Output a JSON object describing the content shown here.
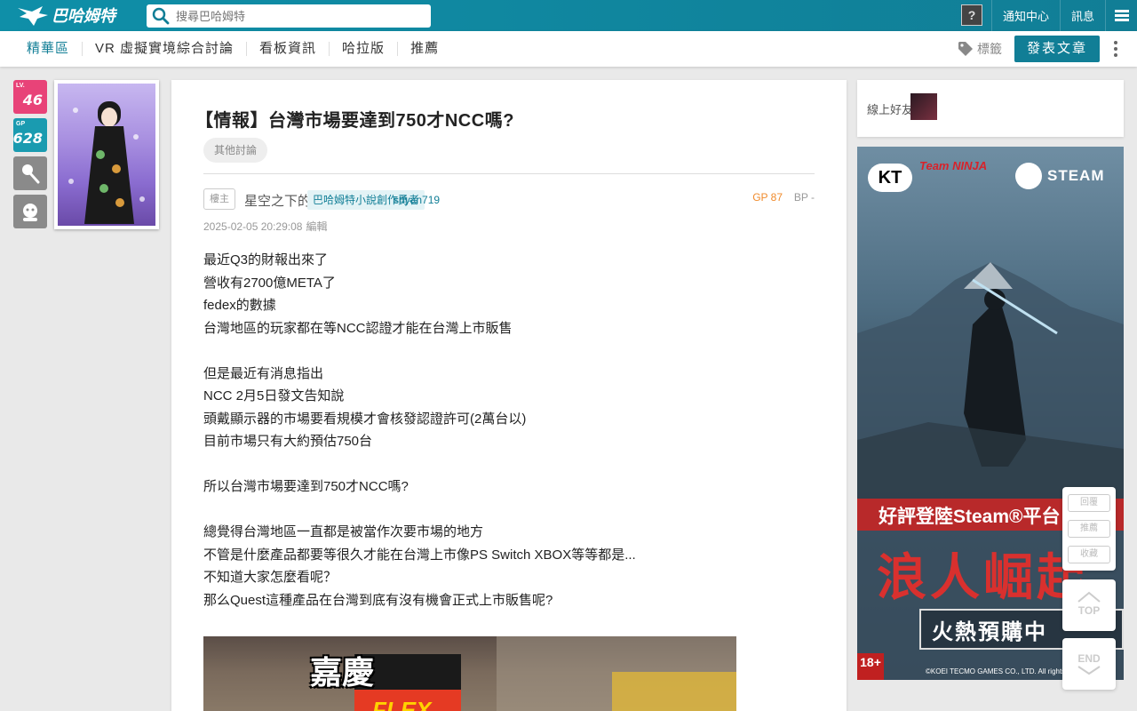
{
  "header": {
    "logo_text": "巴哈姆特",
    "search_placeholder": "搜尋巴哈姆特",
    "avatar_glyph": "?",
    "nav": [
      "通知中心",
      "訊息"
    ],
    "menu_icon": "hamburger-icon"
  },
  "subnav": {
    "items": [
      "精華區",
      "VR 虛擬實境綜合討論",
      "看板資訊",
      "哈拉版",
      "推薦"
    ],
    "tag_label": "標籤",
    "post_button": "發表文章"
  },
  "profile": {
    "lv_label": "LV.",
    "lv_value": "46",
    "gp_label": "GP",
    "gp_value": "628",
    "tool_icons": [
      "wand-icon",
      "monkey-icon"
    ]
  },
  "article": {
    "title": "【情報】台灣市場要達到750才NCC嗎?",
    "category": "其他討論",
    "floor": "樓主",
    "author_name": "星空之下的人",
    "author_title": "巴哈姆特小說創作勇者",
    "author_id": "shyan719",
    "gp": "GP 87",
    "bp": "BP -",
    "time": "2025-02-05 20:29:08",
    "edit_mark": "編輯",
    "body": [
      "最近Q3的財報出來了",
      "營收有2700億META了",
      "fedex的數據",
      "台灣地區的玩家都在等NCC認證才能在台灣上市販售",
      "",
      "但是最近有消息指出",
      "NCC 2月5日發文告知說",
      "頭戴顯示器的市場要看規模才會核發認證許可(2萬台以)",
      "目前市場只有大約預估750台",
      "",
      "所以台灣市場要達到750才NCC嗎?",
      "",
      "總覺得台灣地區一直都是被當作次要市場的地方",
      "不管是什麼產品都要等很久才能在台灣上市像PS Switch XBOX等等都是...",
      "不知道大家怎麼看呢？",
      "那么Quest這種產品在台灣到底有沒有機會正式上市販售呢?"
    ],
    "image_caption": "嘉慶",
    "image_brand": "FLEX"
  },
  "sidebar": {
    "friends_label": "線上好友：",
    "ad": {
      "kt": "KT",
      "ninja": "Team NINJA",
      "steam": "STEAM",
      "line1": "好評登陸Steam®平台",
      "title": "浪人崛起",
      "preorder": "火熱預購中",
      "rating": "18+",
      "copyright": "©KOEI TECMO GAMES CO., LTD. All rights reserved."
    }
  },
  "float_tools": {
    "buttons": [
      "回覆",
      "推薦",
      "收藏"
    ],
    "top": "TOP",
    "end": "END"
  },
  "colors": {
    "brand": "#117e96",
    "lv_badge": "#e84378",
    "gp_badge": "#1a9bb0",
    "gp_text": "#f08b2c"
  }
}
